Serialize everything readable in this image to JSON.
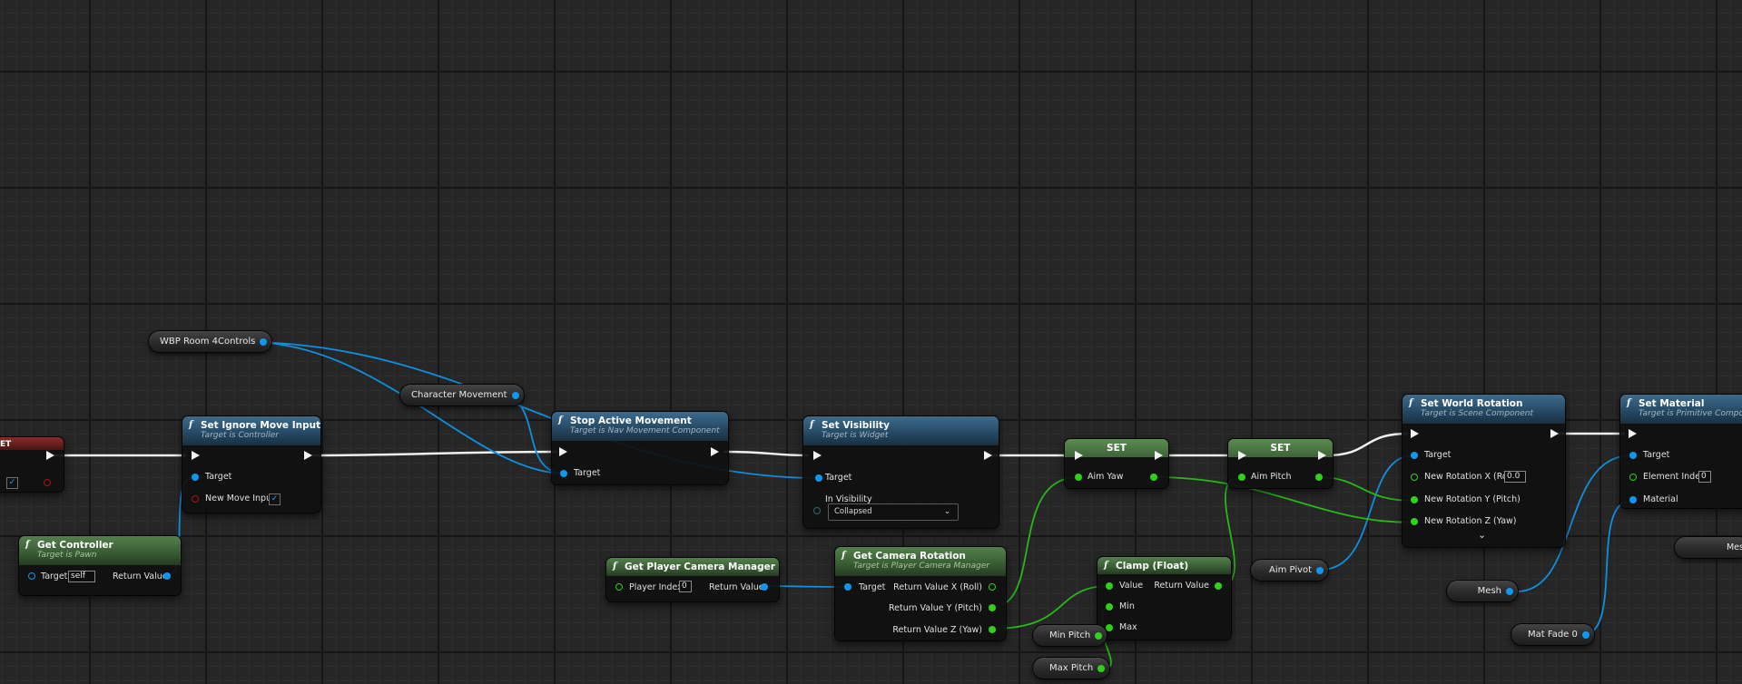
{
  "nodes": {
    "partial_left": {
      "label": "ET"
    },
    "get_controller": {
      "title": "Get Controller",
      "subtitle": "Target is Pawn",
      "target_label": "Target",
      "target_value": "self",
      "return_label": "Return Value"
    },
    "set_ignore_move_input": {
      "title": "Set Ignore Move Input",
      "subtitle": "Target is Controller",
      "target_label": "Target",
      "new_move_input_label": "New Move Input",
      "checked": "✓"
    },
    "stop_active_movement": {
      "title": "Stop Active Movement",
      "subtitle": "Target is Nav Movement Component",
      "target_label": "Target"
    },
    "set_visibility": {
      "title": "Set Visibility",
      "subtitle": "Target is Widget",
      "target_label": "Target",
      "in_visibility_label": "In Visibility",
      "in_visibility_value": "Collapsed"
    },
    "get_player_camera_manager": {
      "title": "Get Player Camera Manager",
      "player_index_label": "Player Index",
      "player_index_value": "0",
      "return_label": "Return Value"
    },
    "get_camera_rotation": {
      "title": "Get Camera Rotation",
      "subtitle": "Target is Player Camera Manager",
      "target_label": "Target",
      "rx_label": "Return Value X (Roll)",
      "ry_label": "Return Value Y (Pitch)",
      "rz_label": "Return Value Z (Yaw)"
    },
    "set_yaw": {
      "title": "SET",
      "pin_label": "Aim Yaw"
    },
    "set_pitch": {
      "title": "SET",
      "pin_label": "Aim Pitch"
    },
    "clamp": {
      "title": "Clamp (Float)",
      "value_label": "Value",
      "min_label": "Min",
      "max_label": "Max",
      "return_label": "Return Value"
    },
    "set_world_rotation": {
      "title": "Set World Rotation",
      "subtitle": "Target is Scene Component",
      "target_label": "Target",
      "rx_label": "New Rotation X (Roll)",
      "rx_value": "0.0",
      "ry_label": "New Rotation Y (Pitch)",
      "rz_label": "New Rotation Z (Yaw)"
    },
    "set_material": {
      "title": "Set Material",
      "subtitle": "Target is Primitive Component",
      "target_label": "Target",
      "element_index_label": "Element Index",
      "element_index_value": "0",
      "material_label": "Material"
    }
  },
  "variables": {
    "wbp_room": "WBP Room 4Controls",
    "character_movement": "Character Movement",
    "aim_pivot": "Aim Pivot",
    "mesh": "Mesh",
    "mesh_partial": "Mesh",
    "mat_fade": "Mat Fade 0",
    "min_pitch": "Min Pitch",
    "max_pitch": "Max Pitch"
  },
  "colors": {
    "exec": "#f2f2f2",
    "object_pin": "#0d97ee",
    "float_pin": "#2dd219",
    "bool_pin": "#b21a1a",
    "function_header": "#254761",
    "pure_header": "#385a33"
  }
}
